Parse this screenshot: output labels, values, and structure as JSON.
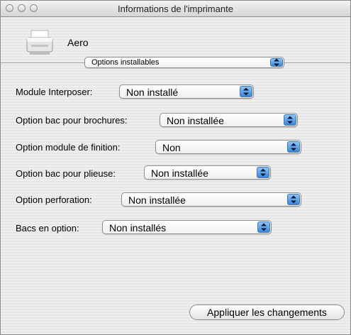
{
  "window": {
    "title": "Informations de l'imprimante"
  },
  "printer": {
    "name": "Aero"
  },
  "section_selector": {
    "value": "Options installables"
  },
  "options": [
    {
      "label": "Module Interposer:",
      "value": "Non installé"
    },
    {
      "label": "Option bac pour brochures:",
      "value": "Non installée"
    },
    {
      "label": "Option module de finition:",
      "value": "Non"
    },
    {
      "label": "Option bac pour plieuse:",
      "value": "Non installée"
    },
    {
      "label": "Option perforation:",
      "value": "Non installée"
    },
    {
      "label": "Bacs en option:",
      "value": "Non installés"
    }
  ],
  "apply_button": {
    "label": "Appliquer les changements"
  },
  "icons": [
    "close-icon",
    "minimize-icon",
    "zoom-icon",
    "printer-icon",
    "popup-arrows-icon"
  ]
}
